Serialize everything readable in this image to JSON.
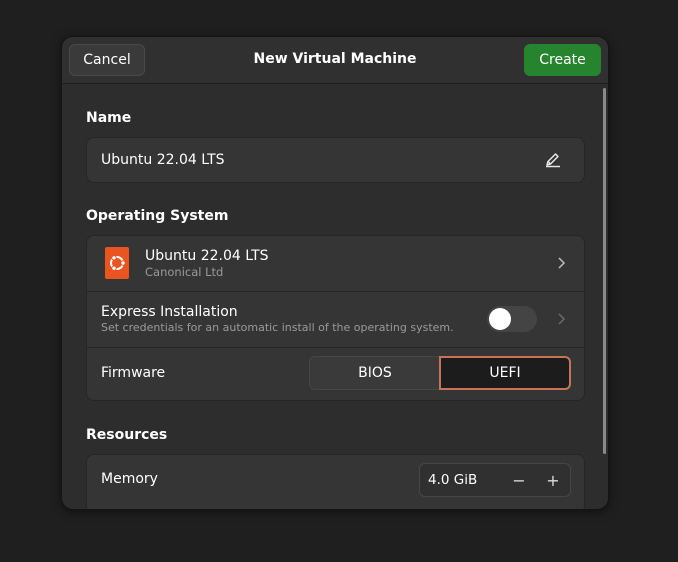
{
  "header": {
    "cancel_label": "Cancel",
    "title": "New Virtual Machine",
    "create_label": "Create"
  },
  "name_section": {
    "label": "Name",
    "value": "Ubuntu 22.04 LTS",
    "edit_icon": "edit-pencil-icon"
  },
  "os_section": {
    "label": "Operating System",
    "os": {
      "name": "Ubuntu 22.04 LTS",
      "vendor": "Canonical Ltd",
      "logo_icon": "ubuntu-logo-icon"
    },
    "express": {
      "title": "Express Installation",
      "subtitle": "Set credentials for an automatic install of the operating system.",
      "enabled": false
    },
    "firmware": {
      "label": "Firmware",
      "options": [
        "BIOS",
        "UEFI"
      ],
      "selected": "UEFI"
    }
  },
  "resources_section": {
    "label": "Resources",
    "memory": {
      "label": "Memory",
      "value": "4.0 GiB",
      "decrement": "−",
      "increment": "+"
    }
  },
  "colors": {
    "accent_green": "#26842f",
    "ubuntu_orange": "#e95420",
    "selected_outline": "#c7735a"
  }
}
